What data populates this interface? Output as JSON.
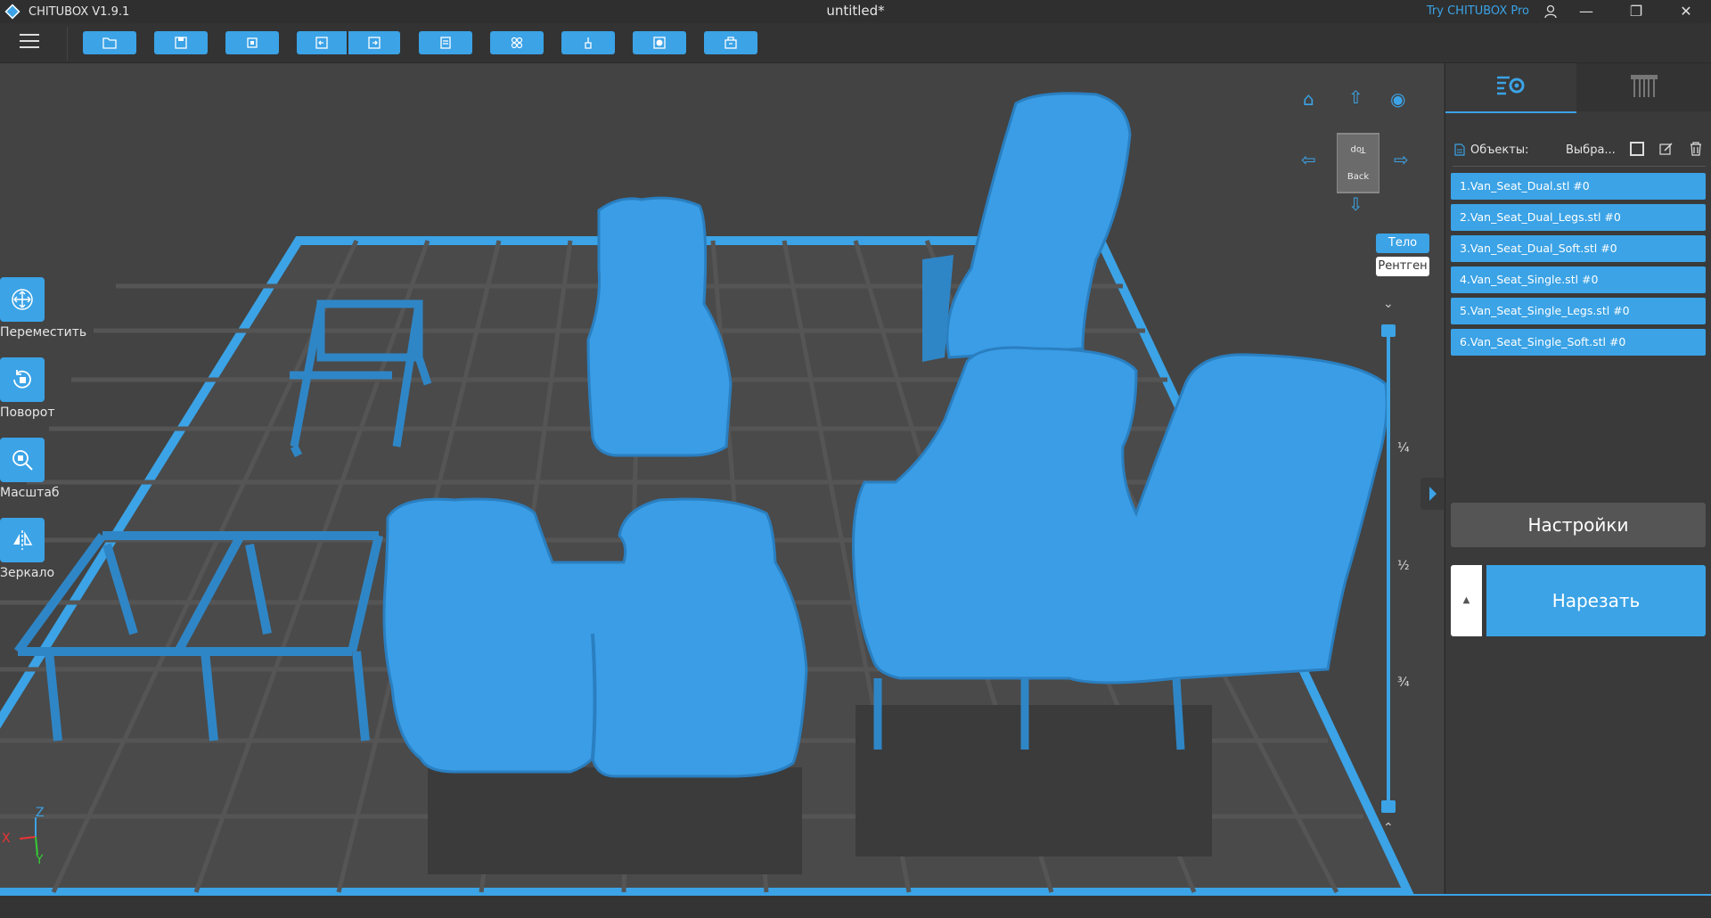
{
  "app": {
    "name": "CHITUBOX V1.9.1",
    "doc_title": "untitled*",
    "try_pro": "Try CHITUBOX Pro"
  },
  "window_controls": {
    "account_icon": "account-icon",
    "minimize": "—",
    "restore": "❐",
    "close": "✕"
  },
  "toolbar": {
    "buttons": [
      "open-file-icon",
      "save-icon",
      "auto-layout-icon",
      "undo-icon",
      "redo-icon",
      "clipboard-icon",
      "copy-models-icon",
      "support-icon",
      "hollow-icon",
      "package-icon"
    ]
  },
  "left_tools": [
    {
      "label": "Переместить",
      "icon": "move-icon"
    },
    {
      "label": "Поворот",
      "icon": "rotate-icon"
    },
    {
      "label": "Масштаб",
      "icon": "scale-icon"
    },
    {
      "label": "Зеркало",
      "icon": "mirror-icon"
    }
  ],
  "view": {
    "cube_top": "Top",
    "cube_back": "Back",
    "mode_body": "Тело",
    "mode_xray": "Рентген",
    "fractions": [
      "¼",
      "½",
      "¾"
    ],
    "axis_z": "Z",
    "axis_x": "X",
    "axis_y": "Y"
  },
  "panel": {
    "objects_label": "Объекты:",
    "select_label": "Выбра...",
    "objects": [
      "1.Van_Seat_Dual.stl #0",
      "2.Van_Seat_Dual_Legs.stl #0",
      "3.Van_Seat_Dual_Soft.stl #0",
      "4.Van_Seat_Single.stl #0",
      "5.Van_Seat_Single_Legs.stl #0",
      "6.Van_Seat_Single_Soft.stl #0"
    ],
    "settings_button": "Настройки",
    "slice_button": "Нарезать",
    "slice_arrow": "▲"
  },
  "colors": {
    "accent": "#3ba3e6",
    "background": "#434343",
    "panel": "#3a3a3a"
  }
}
